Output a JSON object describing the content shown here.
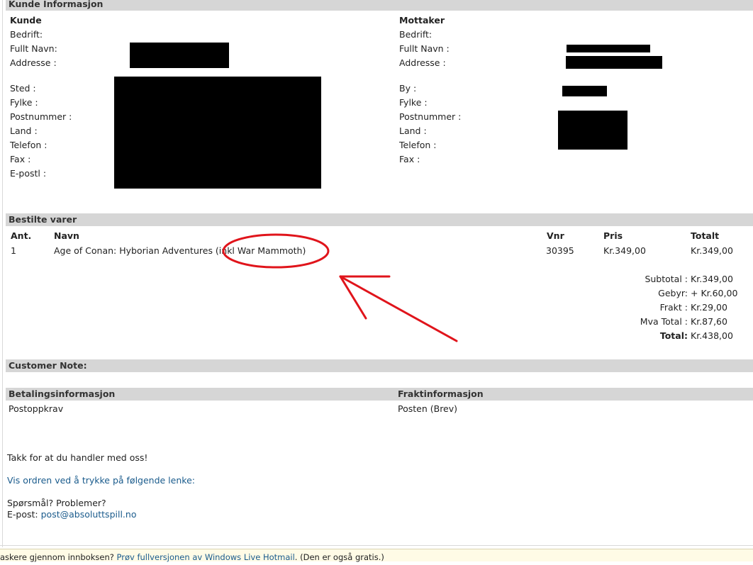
{
  "customer_section": {
    "header": "Kunde Informasjon",
    "kunde": {
      "heading": "Kunde",
      "labels": [
        "Bedrift:",
        "Fullt Navn:",
        "Addresse :",
        "Sted :",
        "Fylke :",
        "Postnummer :",
        "Land :",
        "Telefon :",
        "Fax :",
        "E-postl :"
      ]
    },
    "mottaker": {
      "heading": "Mottaker",
      "labels": [
        "Bedrift:",
        "Fullt Navn :",
        "Addresse :",
        "By :",
        "Fylke :",
        "Postnummer :",
        "Land :",
        "Telefon :",
        "Fax :"
      ]
    }
  },
  "order_section": {
    "header": "Bestilte varer",
    "columns": [
      "Ant.",
      "Navn",
      "Vnr",
      "Pris",
      "Totalt"
    ],
    "rows": [
      {
        "qty": "1",
        "name": "Age of Conan: Hyborian Adventures (inkl War Mammoth)",
        "vnr": "30395",
        "price": "Kr.349,00",
        "total": "Kr.349,00"
      }
    ],
    "totals": [
      {
        "label": "Subtotal :",
        "value": "Kr.349,00",
        "bold": false
      },
      {
        "label": "Gebyr:",
        "value": "+ Kr.60,00",
        "bold": false
      },
      {
        "label": "Frakt :",
        "value": "Kr.29,00",
        "bold": false
      },
      {
        "label": "Mva Total :",
        "value": "Kr.87,60",
        "bold": false
      },
      {
        "label": "Total:",
        "value": "Kr.438,00",
        "bold": true
      }
    ]
  },
  "note_section": {
    "header": "Customer Note:"
  },
  "payment": {
    "header": "Betalingsinformasjon",
    "value": "Postoppkrav"
  },
  "shipping": {
    "header": "Fraktinformasjon",
    "value": "Posten (Brev)"
  },
  "closing": {
    "thanks": "Takk for at du handler med oss!",
    "view_order_link": "Vis ordren ved å trykke på følgende lenke:",
    "questions": "Spørsmål? Problemer?",
    "email_label": "E-post:",
    "email_link": "post@absoluttspill.no"
  },
  "footer": {
    "prefix": "askere gjennom innboksen? ",
    "link": "Prøv fullversjonen av Windows Live Hotmail",
    "suffix": ". (Den er også gratis.)"
  },
  "colors": {
    "header_bar": "#d6d6d6",
    "link": "#1a5b8c",
    "annotation": "#e0141b",
    "redaction": "#000000"
  }
}
